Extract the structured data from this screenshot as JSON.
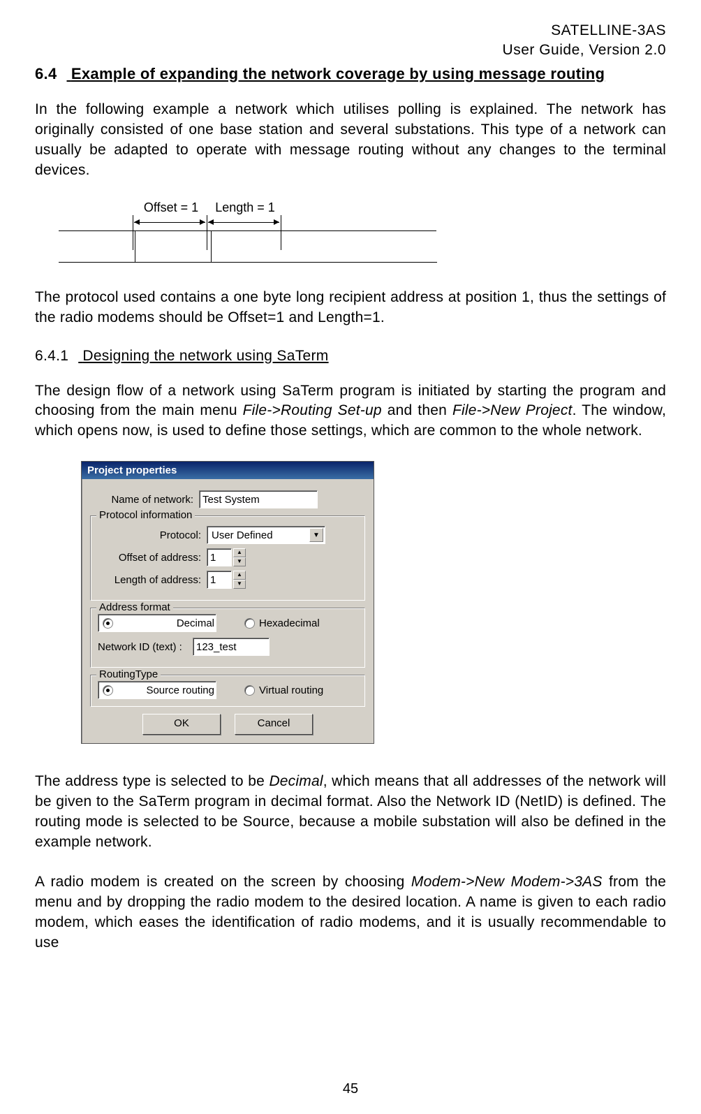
{
  "header": {
    "product": "SATELLINE-3AS",
    "guide": "User Guide, Version 2.0"
  },
  "section": {
    "num": "6.4",
    "title": "Example of expanding the network coverage by using message routing"
  },
  "para1": "In the following example a network which utilises polling is explained. The network has originally consisted of one base station and several substations. This type of a network can usually be adapted to operate with message routing without any changes to the terminal devices.",
  "diagram": {
    "offset_label": "Offset = 1",
    "length_label": "Length = 1"
  },
  "para2": "The protocol used contains a one byte long recipient address at position 1, thus the settings of the radio modems should be Offset=1 and Length=1.",
  "subsection": {
    "num": "6.4.1",
    "title": "Designing the network using SaTerm"
  },
  "para3_a": "The design flow of a network using SaTerm program is initiated by starting the program and choosing from the main menu ",
  "para3_m1": "File->Routing Set-up",
  "para3_b": " and then ",
  "para3_m2": "File->New Project",
  "para3_c": ". The window, which opens now, is used to define those settings, which are common to the whole network.",
  "dialog": {
    "title": "Project properties",
    "name_label": "Name of network:",
    "name_value": "Test System",
    "group_protocol": "Protocol information",
    "protocol_label": "Protocol:",
    "protocol_value": "User Defined",
    "offset_label": "Offset of address:",
    "offset_value": "1",
    "length_label": "Length of address:",
    "length_value": "1",
    "group_addrfmt": "Address format",
    "radio_decimal": "Decimal",
    "radio_hex": "Hexadecimal",
    "netid_label": "Network ID (text) :",
    "netid_value": "123_test",
    "group_routing": "RoutingType",
    "radio_source": "Source routing",
    "radio_virtual": "Virtual routing",
    "ok": "OK",
    "cancel": "Cancel"
  },
  "para4_a": "The address type is selected to be ",
  "para4_m": "Decimal",
  "para4_b": ", which means that all addresses of the network will be given to the SaTerm program in decimal format. Also the Network ID (NetID) is defined. The routing mode is selected to be Source, because a mobile substation will also be defined in the example network.",
  "para5_a": "A radio modem is created on the screen by choosing ",
  "para5_m": "Modem->New Modem->3AS",
  "para5_b": " from the menu and by dropping the radio modem to the desired location. A name is given to each radio modem, which eases the identification of radio modems, and it is usually recommendable to use",
  "page_number": "45"
}
